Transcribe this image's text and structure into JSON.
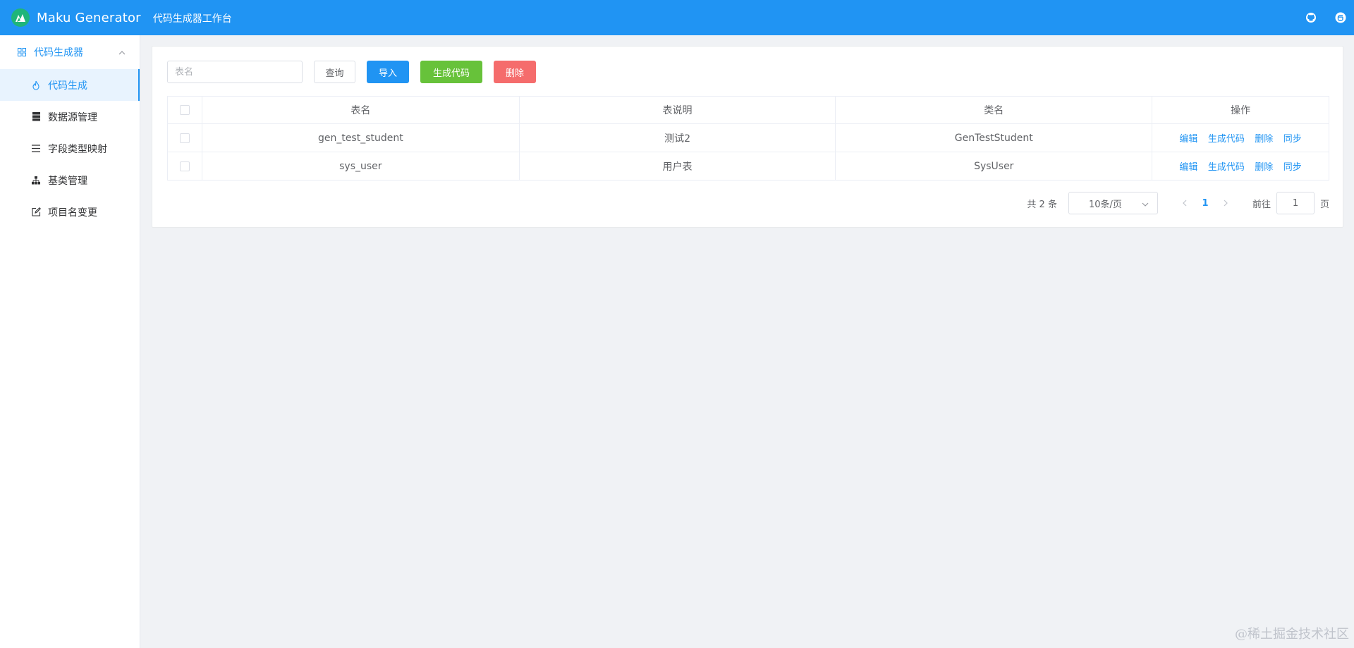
{
  "header": {
    "app_title": "Maku Generator",
    "subtitle": "代码生成器工作台",
    "icons": [
      "github-icon",
      "gitee-icon"
    ]
  },
  "sidebar": {
    "group": {
      "label": "代码生成器",
      "icon": "grid-icon",
      "expanded": true
    },
    "items": [
      {
        "label": "代码生成",
        "icon": "flame-icon",
        "active": true
      },
      {
        "label": "数据源管理",
        "icon": "database-icon",
        "active": false
      },
      {
        "label": "字段类型映射",
        "icon": "list-icon",
        "active": false
      },
      {
        "label": "基类管理",
        "icon": "hierarchy-icon",
        "active": false
      },
      {
        "label": "项目名变更",
        "icon": "edit-icon",
        "active": false
      }
    ]
  },
  "toolbar": {
    "search_placeholder": "表名",
    "search_value": "",
    "query_label": "查询",
    "import_label": "导入",
    "generate_label": "生成代码",
    "delete_label": "删除"
  },
  "table": {
    "columns": [
      "表名",
      "表说明",
      "类名",
      "操作"
    ],
    "rows": [
      {
        "table_name": "gen_test_student",
        "comment": "测试2",
        "class_name": "GenTestStudent"
      },
      {
        "table_name": "sys_user",
        "comment": "用户表",
        "class_name": "SysUser"
      }
    ],
    "actions": [
      "编辑",
      "生成代码",
      "删除",
      "同步"
    ]
  },
  "pagination": {
    "total_text": "共 2 条",
    "page_size": "10条/页",
    "current_page": "1",
    "goto_label": "前往",
    "goto_value": "1",
    "page_suffix": "页"
  },
  "watermark": "@稀土掘金技术社区",
  "colors": {
    "primary": "#2094f3",
    "success": "#67c23a",
    "danger": "#f56c6c",
    "logo": "#1fb57a"
  }
}
